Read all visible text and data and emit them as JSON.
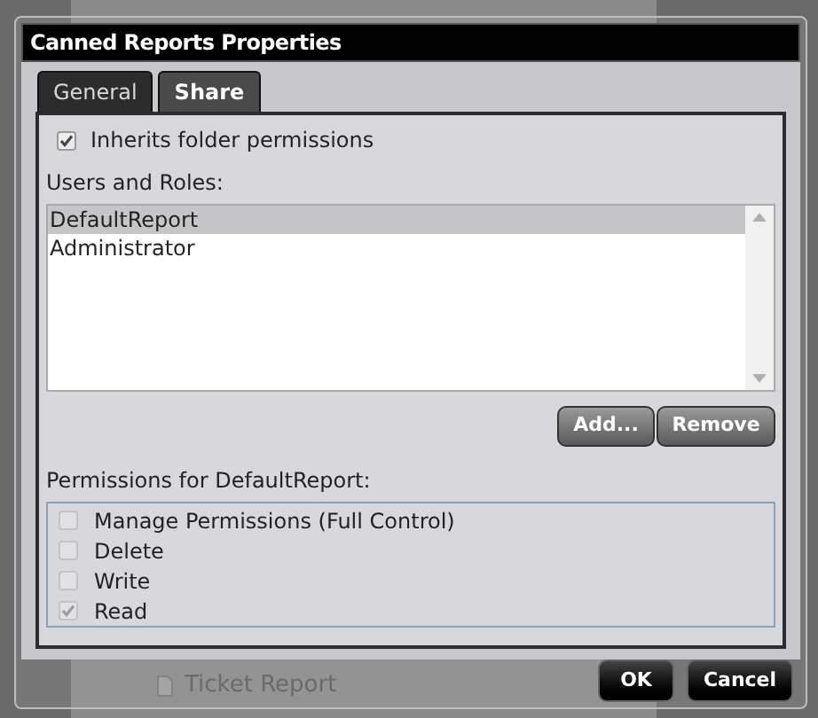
{
  "background": {
    "items": [
      {
        "label": "Ticket Report"
      }
    ]
  },
  "window": {
    "title": "Canned Reports Properties"
  },
  "tabs": [
    {
      "label": "General",
      "selected": false
    },
    {
      "label": "Share",
      "selected": true
    }
  ],
  "inherits": {
    "label": "Inherits folder permissions",
    "checked": true
  },
  "users": {
    "label": "Users and Roles:",
    "items": [
      {
        "label": "DefaultReport",
        "selected": true
      },
      {
        "label": "Administrator",
        "selected": false
      }
    ]
  },
  "user_buttons": [
    "Add...",
    "Remove"
  ],
  "permissions": {
    "label": "Permissions for DefaultReport:",
    "items": [
      {
        "label": "Manage Permissions (Full Control)",
        "checked": false
      },
      {
        "label": "Delete",
        "checked": false
      },
      {
        "label": "Write",
        "checked": false
      },
      {
        "label": "Read",
        "checked": true
      }
    ]
  },
  "buttons": [
    "OK",
    "Cancel"
  ]
}
